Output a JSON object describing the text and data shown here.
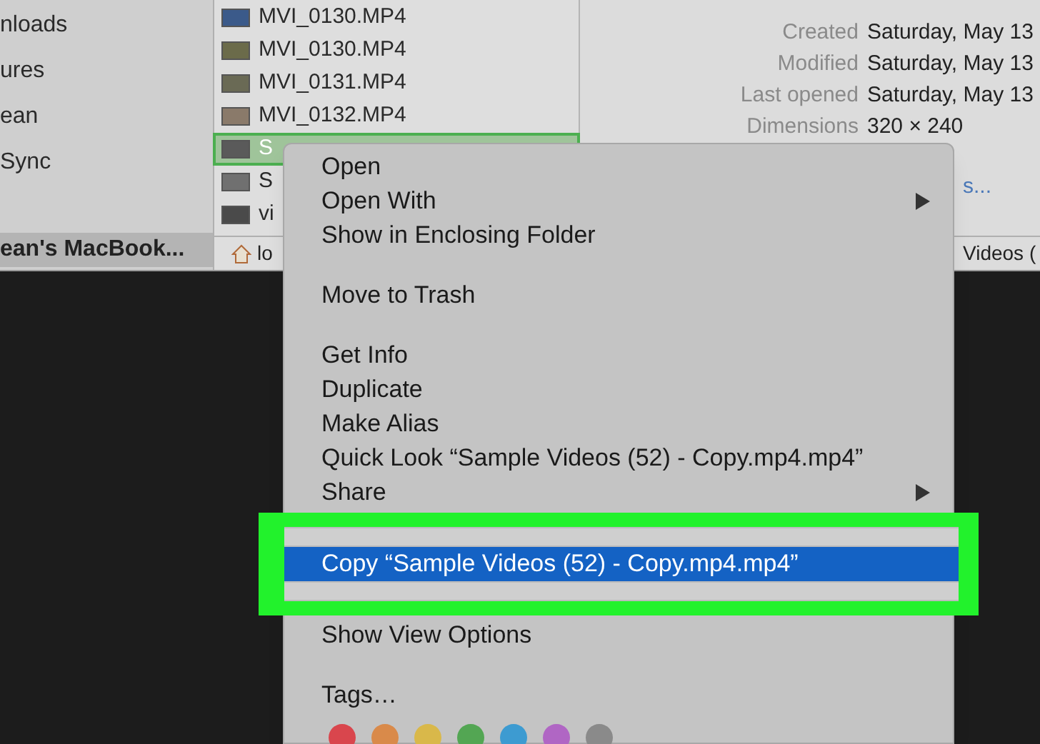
{
  "sidebar": {
    "items": [
      {
        "label": "nloads",
        "selected": false
      },
      {
        "label": "ures",
        "selected": false
      },
      {
        "label": "ean",
        "selected": false
      },
      {
        "label": "Sync",
        "selected": false
      },
      {
        "label": "ean's MacBook...",
        "selected": true
      }
    ]
  },
  "files": {
    "rows": [
      {
        "name": "MVI_0130.MP4",
        "selected": false
      },
      {
        "name": "MVI_0130.MP4",
        "selected": false
      },
      {
        "name": "MVI_0131.MP4",
        "selected": false
      },
      {
        "name": "MVI_0132.MP4",
        "selected": false
      },
      {
        "name": "S",
        "selected": true
      },
      {
        "name": "S",
        "selected": false
      },
      {
        "name": "vi",
        "selected": false
      }
    ],
    "path_bar": {
      "label": "lo"
    }
  },
  "preview": {
    "fields": [
      {
        "label": "Created",
        "value": "Saturday, May 13"
      },
      {
        "label": "Modified",
        "value": "Saturday, May 13"
      },
      {
        "label": "Last opened",
        "value": "Saturday, May 13"
      },
      {
        "label": "Dimensions",
        "value": "320 × 240"
      }
    ],
    "link": "s...",
    "path": "Videos ("
  },
  "context_menu": {
    "items": [
      {
        "kind": "item",
        "label": "Open",
        "submenu": false,
        "highlighted": false
      },
      {
        "kind": "item",
        "label": "Open With",
        "submenu": true,
        "highlighted": false
      },
      {
        "kind": "item",
        "label": "Show in Enclosing Folder",
        "submenu": false,
        "highlighted": false
      },
      {
        "kind": "separator"
      },
      {
        "kind": "item",
        "label": "Move to Trash",
        "submenu": false,
        "highlighted": false
      },
      {
        "kind": "separator"
      },
      {
        "kind": "item",
        "label": "Get Info",
        "submenu": false,
        "highlighted": false
      },
      {
        "kind": "item",
        "label": "Duplicate",
        "submenu": false,
        "highlighted": false
      },
      {
        "kind": "item",
        "label": "Make Alias",
        "submenu": false,
        "highlighted": false
      },
      {
        "kind": "item",
        "label": "Quick Look “Sample Videos (52) - Copy.mp4.mp4”",
        "submenu": false,
        "highlighted": false
      },
      {
        "kind": "item",
        "label": "Share",
        "submenu": true,
        "highlighted": false
      },
      {
        "kind": "item",
        "label": "Copy “Sample Videos (52) - Copy.mp4.mp4”",
        "submenu": false,
        "highlighted": true
      },
      {
        "kind": "item",
        "label": "Show View Options",
        "submenu": false,
        "highlighted": false
      },
      {
        "kind": "separator"
      },
      {
        "kind": "item",
        "label": "Tags…",
        "submenu": false,
        "highlighted": false
      },
      {
        "kind": "tags",
        "dots": [
          {
            "color": "#d9464d"
          },
          {
            "color": "#d98a4a"
          },
          {
            "color": "#d9b84a"
          },
          {
            "color": "#53a653"
          },
          {
            "color": "#3d9bd1"
          },
          {
            "color": "#b066c4"
          },
          {
            "color": "#8a8a8a"
          }
        ]
      }
    ]
  }
}
